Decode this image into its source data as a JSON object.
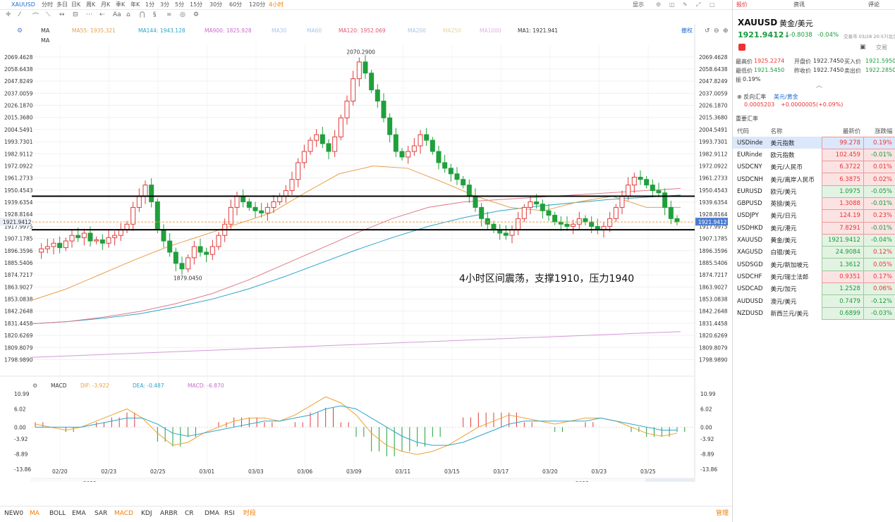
{
  "topbar": {
    "symbol": "XAUUSD",
    "periods": [
      "分时",
      "多日",
      "日K",
      "周K",
      "月K",
      "季K",
      "年K",
      "1分",
      "3分",
      "5分",
      "15分",
      "30分",
      "60分",
      "120分",
      "4小时"
    ],
    "active_period": "4小时",
    "right_tools": [
      "显示"
    ]
  },
  "toolbar": {
    "ma_label": "MA",
    "ma_label2": "MA",
    "restore": "撤权"
  },
  "chart": {
    "price_ticks": [
      "2069.4628",
      "2058.6438",
      "2047.8249",
      "2037.0059",
      "2026.1870",
      "2015.3680",
      "2004.5491",
      "1993.7301",
      "1982.9112",
      "1972.0922",
      "1961.2733",
      "1950.4543",
      "1939.6354",
      "1928.8164",
      "1917.9975",
      "1907.1785",
      "1896.3596",
      "1885.5406",
      "1874.7217",
      "1863.9027",
      "1853.0838",
      "1842.2648",
      "1831.4458",
      "1820.6269",
      "1809.8079",
      "1798.9890"
    ],
    "current_price": "1921.9412",
    "high_label": "2070.2900",
    "low_label": "1879.0450",
    "annotation": "4小时区间震荡，支撑1910，压力1940",
    "ma_legend": [
      {
        "label": "MA55: 1935.321",
        "color": "#e8a04a"
      },
      {
        "label": "MA144: 1943.128",
        "color": "#2aa6c9"
      },
      {
        "label": "MA900: 1825.928",
        "color": "#c86ec8"
      },
      {
        "label": "MA30",
        "color": "#a9c4e8"
      },
      {
        "label": "MA60",
        "color": "#a9c4e8"
      },
      {
        "label": "MA120: 1952.069",
        "color": "#e05a6a"
      },
      {
        "label": "MA200",
        "color": "#a9c4e8"
      },
      {
        "label": "MA250",
        "color": "#e9d3a0"
      },
      {
        "label": "MA1000",
        "color": "#e0b0e0"
      },
      {
        "label": "MA1: 1921.941",
        "color": "#333333"
      }
    ],
    "macd_legend": [
      {
        "label": "MACD",
        "color": "#333333"
      },
      {
        "label": "DIF: -3.922",
        "color": "#f0a030"
      },
      {
        "label": "DEA: -0.487",
        "color": "#2aa6c9"
      },
      {
        "label": "MACD: -6.870",
        "color": "#c86ec8"
      }
    ],
    "macd_ticks": [
      "10.99",
      "6.02",
      "0.00",
      "-3.92",
      "-8.89",
      "-13.86"
    ],
    "date_labels": [
      "02/20",
      "02/23",
      "02/25",
      "03/01",
      "03/03",
      "03/06",
      "03/09",
      "03/11",
      "03/15",
      "03/17",
      "03/20",
      "03/23",
      "03/25"
    ],
    "year_labels": [
      "2021",
      "2022"
    ]
  },
  "bottombar": {
    "indicators": [
      "NEW0",
      "MA",
      "BOLL",
      "EMA",
      "SAR",
      "MACD",
      "KDJ",
      "ARBR",
      "CR",
      "DMA",
      "RSI",
      "时段"
    ],
    "highlighted": [
      "MA",
      "MACD",
      "时段"
    ],
    "manage": "管理"
  },
  "right_panel": {
    "tabs": [
      "报价",
      "资讯",
      "评论"
    ],
    "active_tab": "报价",
    "symbol": "XAUUSD",
    "name": "黄金/美元",
    "price": "1921.9412",
    "change": "-0.8038",
    "change_pct": "-0.04%",
    "trade_time": "交易市 03/28 20:57(北京)",
    "trade_btn": "交易",
    "quotes": [
      {
        "label": "最高价",
        "value": "1925.2274",
        "color": "red"
      },
      {
        "label": "开盘价",
        "value": "1922.7450",
        "color": "dark"
      },
      {
        "label": "买入价",
        "value": "1921.5950",
        "color": "grn"
      },
      {
        "label": "最低价",
        "value": "1921.5450",
        "color": "grn"
      },
      {
        "label": "昨收价",
        "value": "1922.7450",
        "color": "dark"
      },
      {
        "label": "卖出价",
        "value": "1922.2850",
        "color": "grn"
      },
      {
        "label": "振",
        "value": "0.19%",
        "color": "dark"
      }
    ],
    "reverse_rate": {
      "title": "反向汇率",
      "pair": "美元/黄金",
      "value": "0.0005203",
      "change": "+0.0000005(+0.09%)"
    },
    "watch_title": "重要汇率",
    "watch_headers": [
      "代码",
      "名称",
      "最新价",
      "涨跌幅"
    ],
    "watchlist": [
      {
        "code": "USDinde",
        "name": "美元指数",
        "price": "99.278",
        "pct": "0.19%",
        "dir": "up"
      },
      {
        "code": "EURinde",
        "name": "欧元指数",
        "price": "102.459",
        "pct": "-0.01%",
        "dir": "up"
      },
      {
        "code": "USDCNY",
        "name": "美元/人民币",
        "price": "6.3722",
        "pct": "0.01%",
        "dir": "up"
      },
      {
        "code": "USDCNH",
        "name": "美元/离岸人民币",
        "price": "6.3875",
        "pct": "0.02%",
        "dir": "up"
      },
      {
        "code": "EURUSD",
        "name": "欧元/美元",
        "price": "1.0975",
        "pct": "-0.05%",
        "dir": "down"
      },
      {
        "code": "GBPUSD",
        "name": "英镑/美元",
        "price": "1.3088",
        "pct": "-0.01%",
        "dir": "up"
      },
      {
        "code": "USDJPY",
        "name": "美元/日元",
        "price": "124.19",
        "pct": "0.23%",
        "dir": "up"
      },
      {
        "code": "USDHKD",
        "name": "美元/港元",
        "price": "7.8291",
        "pct": "-0.01%",
        "dir": "up"
      },
      {
        "code": "XAUUSD",
        "name": "黄金/美元",
        "price": "1921.9412",
        "pct": "-0.04%",
        "dir": "down"
      },
      {
        "code": "XAGUSD",
        "name": "白银/美元",
        "price": "24.9084",
        "pct": "0.12%",
        "dir": "down"
      },
      {
        "code": "USDSGD",
        "name": "美元/新加坡元",
        "price": "1.3612",
        "pct": "0.05%",
        "dir": "down"
      },
      {
        "code": "USDCHF",
        "name": "美元/瑞士法郎",
        "price": "0.9351",
        "pct": "0.17%",
        "dir": "up"
      },
      {
        "code": "USDCAD",
        "name": "美元/加元",
        "price": "1.2528",
        "pct": "0.06%",
        "dir": "down"
      },
      {
        "code": "AUDUSD",
        "name": "澳元/美元",
        "price": "0.7479",
        "pct": "-0.12%",
        "dir": "down"
      },
      {
        "code": "NZDUSD",
        "name": "新西兰元/美元",
        "price": "0.6899",
        "pct": "-0.03%",
        "dir": "down"
      }
    ]
  },
  "chart_data": {
    "type": "candlestick",
    "symbol": "XAUUSD",
    "timeframe": "4小时",
    "ylim": [
      1793,
      2075
    ],
    "high": 2070.29,
    "low": 1879.045,
    "last": 1921.9412,
    "support": 1910,
    "resistance": 1940,
    "ma": {
      "MA55": 1935.321,
      "MA144": 1943.128,
      "MA900": 1825.928,
      "MA120": 1952.069,
      "MA1": 1921.941
    },
    "close_path": [
      1895,
      1898,
      1900,
      1903,
      1899,
      1905,
      1910,
      1908,
      1912,
      1905,
      1906,
      1903,
      1908,
      1910,
      1915,
      1920,
      1935,
      1945,
      1955,
      1940,
      1915,
      1905,
      1895,
      1885,
      1880,
      1890,
      1900,
      1895,
      1893,
      1900,
      1910,
      1920,
      1935,
      1945,
      1940,
      1935,
      1932,
      1930,
      1935,
      1940,
      1945,
      1950,
      1960,
      1975,
      1985,
      1995,
      2000,
      1992,
      1985,
      1998,
      2015,
      2030,
      2050,
      2065,
      2055,
      2040,
      2030,
      2015,
      2000,
      1985,
      1980,
      1985,
      1990,
      2000,
      1995,
      1985,
      1975,
      1970,
      1965,
      1960,
      1955,
      1945,
      1935,
      1925,
      1920,
      1915,
      1912,
      1910,
      1915,
      1925,
      1935,
      1940,
      1938,
      1932,
      1928,
      1922,
      1920,
      1918,
      1920,
      1925,
      1922,
      1918,
      1915,
      1918,
      1925,
      1935,
      1945,
      1955,
      1962,
      1960,
      1955,
      1950,
      1948,
      1935,
      1925,
      1922
    ],
    "macd_dif": [
      1,
      0,
      -1,
      0,
      2,
      4,
      6,
      3,
      -2,
      -6,
      -5,
      -2,
      0,
      2,
      3,
      3,
      2,
      4,
      7,
      10,
      8,
      4,
      -2,
      -6,
      -8,
      -9,
      -8,
      -6,
      -3,
      0,
      2,
      4,
      3,
      2,
      1,
      2,
      3,
      3,
      2,
      0,
      -2,
      -3,
      -2
    ],
    "macd_dea": [
      0,
      0,
      0,
      0,
      1,
      2,
      3,
      3,
      1,
      -2,
      -3,
      -2,
      -1,
      0,
      1,
      2,
      2,
      3,
      4,
      6,
      7,
      6,
      3,
      0,
      -3,
      -5,
      -6,
      -6,
      -5,
      -3,
      -1,
      1,
      2,
      2,
      2,
      2,
      2,
      3,
      2,
      1,
      0,
      -1,
      -1
    ]
  }
}
